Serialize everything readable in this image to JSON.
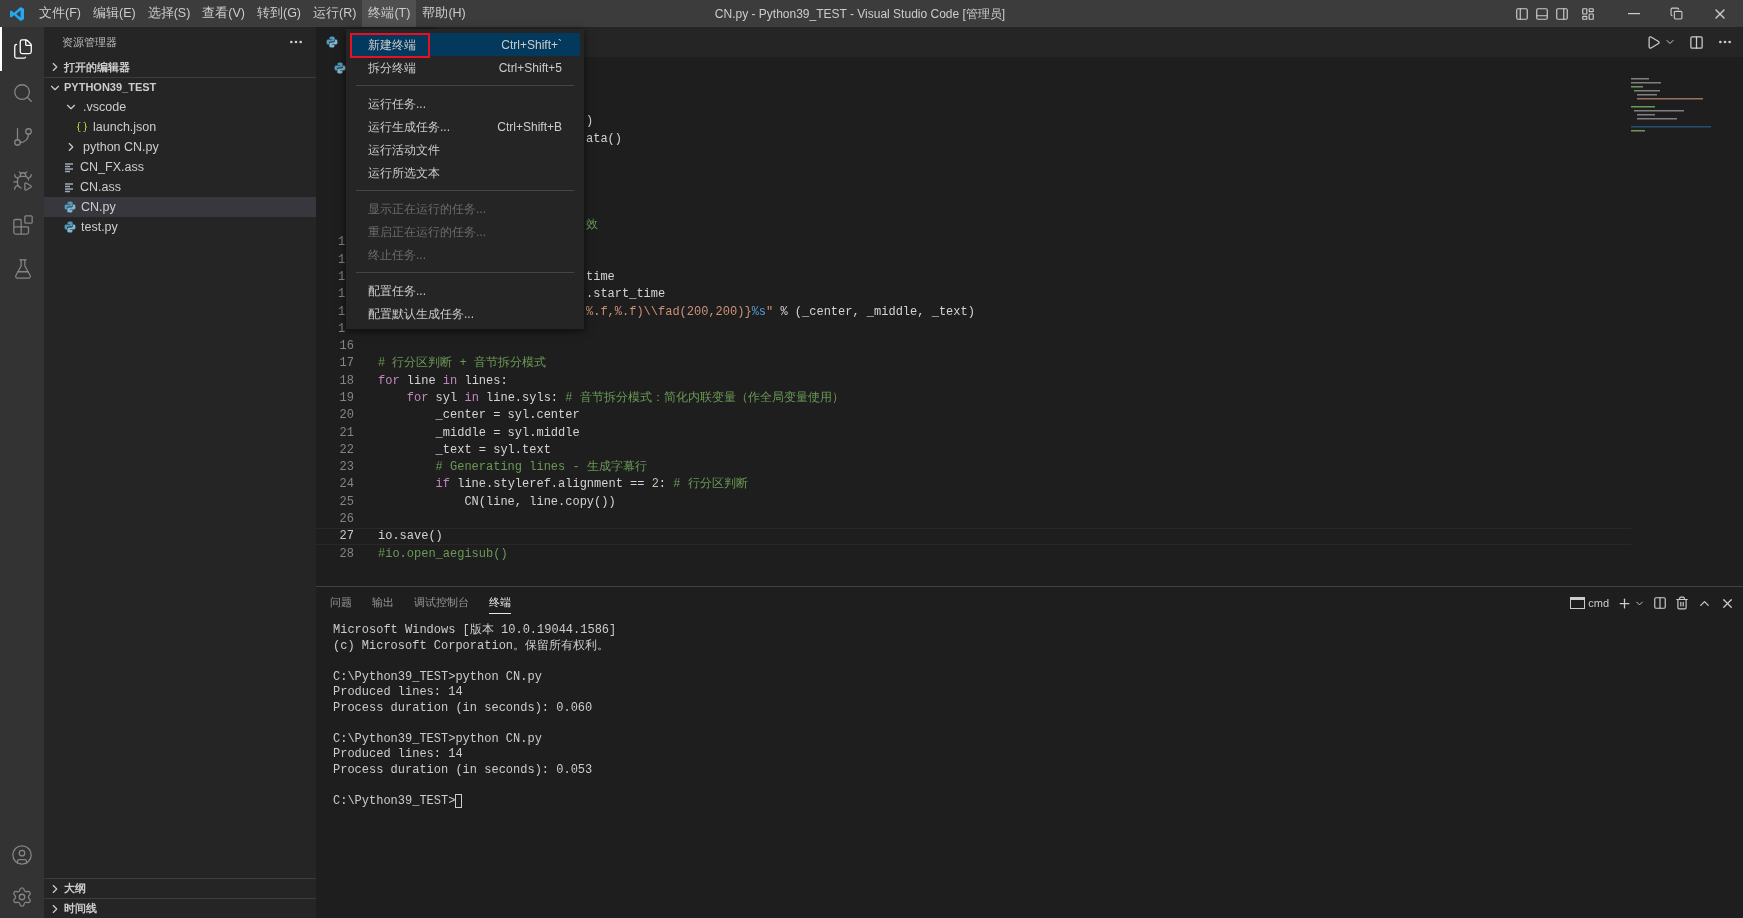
{
  "title_bar": {
    "title": "CN.py - Python39_TEST - Visual Studio Code [管理员]",
    "menus": [
      {
        "label": "文件(F)",
        "open": false
      },
      {
        "label": "编辑(E)",
        "open": false
      },
      {
        "label": "选择(S)",
        "open": false
      },
      {
        "label": "查看(V)",
        "open": false
      },
      {
        "label": "转到(G)",
        "open": false
      },
      {
        "label": "运行(R)",
        "open": false
      },
      {
        "label": "终端(T)",
        "open": true
      },
      {
        "label": "帮助(H)",
        "open": false
      }
    ]
  },
  "activity_bar": {
    "items": [
      {
        "kind": "explorer",
        "selected": true
      },
      {
        "kind": "search",
        "selected": false
      },
      {
        "kind": "source-control",
        "selected": false
      },
      {
        "kind": "run-debug",
        "selected": false
      },
      {
        "kind": "extensions",
        "selected": false
      },
      {
        "kind": "testing",
        "selected": false
      }
    ],
    "bottom_items": [
      {
        "kind": "account"
      },
      {
        "kind": "settings"
      }
    ]
  },
  "sidebar": {
    "title": "资源管理器",
    "sections": [
      {
        "label": "打开的编辑器",
        "expanded": false
      },
      {
        "label": "PYTHON39_TEST",
        "expanded": true,
        "children": [
          {
            "label": ".vscode",
            "kind": "folder",
            "expanded": true,
            "selected": false,
            "children": [
              {
                "label": "launch.json",
                "kind": "json",
                "selected": false
              }
            ]
          },
          {
            "label": "python CN.py",
            "kind": "folder",
            "expanded": false,
            "selected": false
          },
          {
            "label": "CN_FX.ass",
            "kind": "text",
            "selected": false
          },
          {
            "label": "CN.ass",
            "kind": "text",
            "selected": false
          },
          {
            "label": "CN.py",
            "kind": "python",
            "selected": true
          },
          {
            "label": "test.py",
            "kind": "python",
            "selected": false
          }
        ]
      }
    ],
    "bottom_sections": [
      {
        "label": "大纲",
        "expanded": false
      },
      {
        "label": "时间线",
        "expanded": false
      }
    ]
  },
  "menu": {
    "items": [
      {
        "kind": "item",
        "label": "新建终端",
        "shortcut": "Ctrl+Shift+`",
        "selected": true,
        "disabled": false,
        "outlined": true
      },
      {
        "kind": "item",
        "label": "拆分终端",
        "shortcut": "Ctrl+Shift+5",
        "selected": false,
        "disabled": false,
        "outlined": false
      },
      {
        "kind": "separator"
      },
      {
        "kind": "item",
        "label": "运行任务...",
        "selected": false,
        "disabled": false,
        "outlined": false
      },
      {
        "kind": "item",
        "label": "运行生成任务...",
        "shortcut": "Ctrl+Shift+B",
        "selected": false,
        "disabled": false,
        "outlined": false
      },
      {
        "kind": "item",
        "label": "运行活动文件",
        "selected": false,
        "disabled": false,
        "outlined": false
      },
      {
        "kind": "item",
        "label": "运行所选文本",
        "selected": false,
        "disabled": false,
        "outlined": false
      },
      {
        "kind": "separator"
      },
      {
        "kind": "item",
        "label": "显示正在运行的任务...",
        "selected": false,
        "disabled": true,
        "outlined": false
      },
      {
        "kind": "item",
        "label": "重启正在运行的任务...",
        "selected": false,
        "disabled": true,
        "outlined": false
      },
      {
        "kind": "item",
        "label": "终止任务...",
        "selected": false,
        "disabled": true,
        "outlined": false
      },
      {
        "kind": "separator"
      },
      {
        "kind": "item",
        "label": "配置任务...",
        "selected": false,
        "disabled": false,
        "outlined": false
      },
      {
        "kind": "item",
        "label": "配置默认生成任务...",
        "selected": false,
        "disabled": false,
        "outlined": false
      }
    ]
  },
  "editor": {
    "lines": [
      {
        "kind": "partial"
      },
      {
        "kind": "partial"
      },
      {
        "kind": "partial",
        "tokens": [
          {
            "t": ")",
            "kind": "plain"
          }
        ]
      },
      {
        "kind": "partial",
        "tokens": [
          {
            "t": "ata()",
            "kind": "plain"
          }
        ]
      },
      {
        "kind": "partial"
      },
      {
        "kind": "partial"
      },
      {
        "kind": "partial"
      },
      {
        "kind": "partial"
      },
      {
        "kind": "partial",
        "tokens": [
          {
            "t": "效",
            "kind": "comment"
          }
        ]
      },
      {
        "kind": "partial",
        "number": "1"
      },
      {
        "kind": "partial",
        "number": "1"
      },
      {
        "kind": "partial",
        "number": "1",
        "tokens": [
          {
            "t": "time",
            "kind": "plain"
          }
        ]
      },
      {
        "kind": "partial",
        "number": "1",
        "tokens": [
          {
            "t": ".start_time",
            "kind": "plain"
          }
        ]
      },
      {
        "kind": "partial",
        "number": "1",
        "tokens": [
          {
            "t": "%.f,%.f)\\\\fad(200,200)}",
            "kind": "string"
          },
          {
            "t": "%s",
            "kind": "escape"
          },
          {
            "t": "\"",
            "kind": "string"
          },
          {
            "t": " % (_center, _middle, _text)",
            "kind": "plain"
          }
        ]
      },
      {
        "kind": "partial",
        "number": "1"
      },
      {
        "kind": "full",
        "number": "16",
        "current": false
      },
      {
        "kind": "full",
        "number": "17",
        "current": false,
        "tokens": [
          {
            "t": "# 行分区判断 + 音节拆分模式",
            "kind": "comment"
          }
        ]
      },
      {
        "kind": "full",
        "number": "18",
        "current": false,
        "tokens": [
          {
            "t": "for",
            "kind": "keyword"
          },
          {
            "t": " line ",
            "kind": "plain"
          },
          {
            "t": "in",
            "kind": "keyword"
          },
          {
            "t": " lines:",
            "kind": "plain"
          }
        ]
      },
      {
        "kind": "full",
        "number": "19",
        "current": false,
        "tokens": [
          {
            "t": "    for",
            "kind": "keyword"
          },
          {
            "t": " syl ",
            "kind": "plain"
          },
          {
            "t": "in",
            "kind": "keyword"
          },
          {
            "t": " line.syls: ",
            "kind": "plain"
          },
          {
            "t": "# 音节拆分模式：简化内联变量（作全局变量使用）",
            "kind": "comment"
          }
        ]
      },
      {
        "kind": "full",
        "number": "20",
        "current": false,
        "tokens": [
          {
            "t": "        _center = syl.center",
            "kind": "plain"
          }
        ]
      },
      {
        "kind": "full",
        "number": "21",
        "current": false,
        "tokens": [
          {
            "t": "        _middle = syl.middle",
            "kind": "plain"
          }
        ]
      },
      {
        "kind": "full",
        "number": "22",
        "current": false,
        "tokens": [
          {
            "t": "        _text = syl.text",
            "kind": "plain"
          }
        ]
      },
      {
        "kind": "full",
        "number": "23",
        "current": false,
        "tokens": [
          {
            "t": "        # Generating lines - 生成字幕行",
            "kind": "comment"
          }
        ]
      },
      {
        "kind": "full",
        "number": "24",
        "current": false,
        "tokens": [
          {
            "t": "        if",
            "kind": "keyword"
          },
          {
            "t": " line.styleref.alignment == ",
            "kind": "plain"
          },
          {
            "t": "2",
            "kind": "number"
          },
          {
            "t": ": ",
            "kind": "plain"
          },
          {
            "t": "# 行分区判断",
            "kind": "comment"
          }
        ]
      },
      {
        "kind": "full",
        "number": "25",
        "current": false,
        "tokens": [
          {
            "t": "            CN(line, line.copy())",
            "kind": "plain"
          }
        ]
      },
      {
        "kind": "full",
        "number": "26",
        "current": false
      },
      {
        "kind": "full",
        "number": "27",
        "current": true,
        "tokens": [
          {
            "t": "io.save()",
            "kind": "plain"
          }
        ]
      },
      {
        "kind": "full",
        "number": "28",
        "current": false,
        "tokens": [
          {
            "t": "#io.open_aegisub()",
            "kind": "comment"
          }
        ]
      }
    ]
  },
  "panel": {
    "tabs": [
      {
        "label": "问题",
        "selected": false
      },
      {
        "label": "输出",
        "selected": false
      },
      {
        "label": "调试控制台",
        "selected": false
      },
      {
        "label": "终端",
        "selected": true
      }
    ],
    "terminal_name": "cmd",
    "terminal_blocks": [
      [
        "Microsoft Windows [版本 10.0.19044.1586]",
        "(c) Microsoft Corporation。保留所有权利。"
      ],
      [
        "C:\\Python39_TEST>python CN.py",
        "Produced lines: 14",
        "Process duration (in seconds): 0.060"
      ],
      [
        "C:\\Python39_TEST>python CN.py",
        "Produced lines: 14",
        "Process duration (in seconds): 0.053"
      ]
    ],
    "prompt": "C:\\Python39_TEST>"
  }
}
